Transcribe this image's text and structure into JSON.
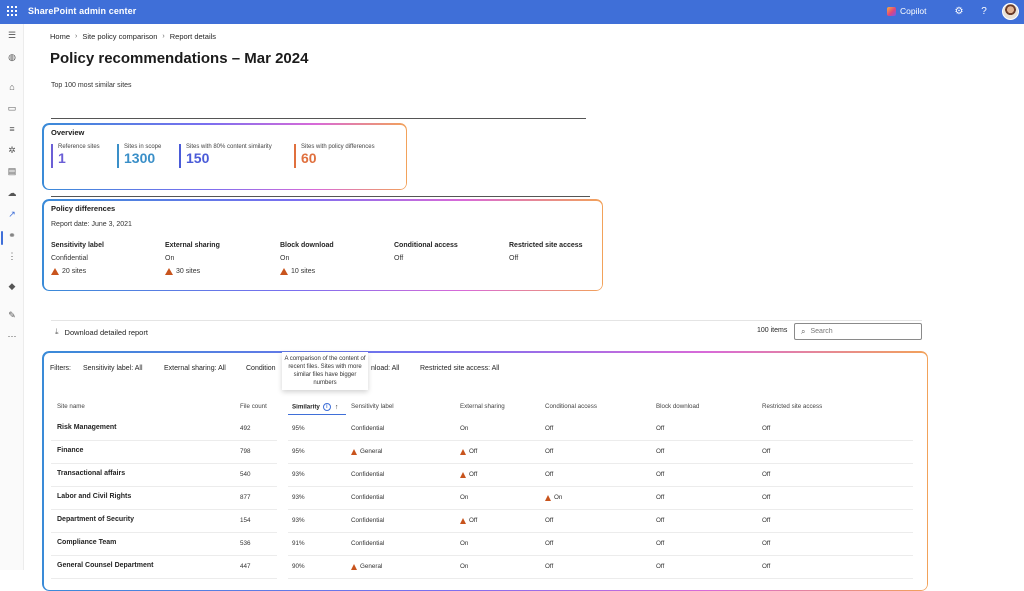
{
  "app": {
    "title": "SharePoint admin center",
    "copilot_label": "Copilot"
  },
  "colors": {
    "topbar": "#3f6fd8",
    "warning": "#c8541d",
    "stat_reference": "#6b5fd6",
    "stat_scope": "#3a8fc8",
    "stat_similarity": "#4a5bd8",
    "stat_policy": "#e0703e"
  },
  "breadcrumb": [
    "Home",
    "Site policy comparison",
    "Report details"
  ],
  "page": {
    "title": "Policy recommendations – Mar 2024",
    "subtitle": "Top 100 most similar sites"
  },
  "overview": {
    "title": "Overview",
    "stats": [
      {
        "label": "Reference sites",
        "value": "1"
      },
      {
        "label": "Sites in scope",
        "value": "1300"
      },
      {
        "label": "Sites with 80% content similarity",
        "value": "150"
      },
      {
        "label": "Sites with policy differences",
        "value": "60"
      }
    ]
  },
  "policy_differences": {
    "title": "Policy differences",
    "report_date": "Report date: June 3, 2021",
    "columns": [
      {
        "header": "Sensitivity label",
        "value": "Confidential",
        "warning": "20 sites"
      },
      {
        "header": "External sharing",
        "value": "On",
        "warning": "30 sites"
      },
      {
        "header": "Block download",
        "value": "On",
        "warning": "10 sites"
      },
      {
        "header": "Conditional access",
        "value": "Off",
        "warning": ""
      },
      {
        "header": "Restricted site access",
        "value": "Off",
        "warning": ""
      }
    ]
  },
  "toolbar": {
    "download_label": "Download detailed report",
    "items_count": "100 items",
    "search_placeholder": "Search"
  },
  "filters": {
    "label": "Filters:",
    "items": [
      "Sensitivity label: All",
      "External sharing: All",
      "Condition",
      "nload: All",
      "Restricted site access: All"
    ]
  },
  "tooltip": "A comparison of the content of recent files. Sites with more similar files have bigger numbers",
  "table": {
    "headers": [
      "Site name",
      "File count",
      "Similarity",
      "Sensitivity label",
      "External sharing",
      "Conditional access",
      "Block download",
      "Restricted site access"
    ],
    "rows": [
      {
        "name": "Risk Management",
        "files": "492",
        "similarity": "95%",
        "label": "Confidential",
        "label_warn": false,
        "sharing": "On",
        "sharing_warn": false,
        "cond": "Off",
        "cond_warn": false,
        "block": "Off",
        "restricted": "Off"
      },
      {
        "name": "Finance",
        "files": "798",
        "similarity": "95%",
        "label": "General",
        "label_warn": true,
        "sharing": "Off",
        "sharing_warn": true,
        "cond": "Off",
        "cond_warn": false,
        "block": "Off",
        "restricted": "Off"
      },
      {
        "name": "Transactional affairs",
        "files": "540",
        "similarity": "93%",
        "label": "Confidential",
        "label_warn": false,
        "sharing": "Off",
        "sharing_warn": true,
        "cond": "Off",
        "cond_warn": false,
        "block": "Off",
        "restricted": "Off"
      },
      {
        "name": "Labor and Civil Rights",
        "files": "877",
        "similarity": "93%",
        "label": "Confidential",
        "label_warn": false,
        "sharing": "On",
        "sharing_warn": false,
        "cond": "On",
        "cond_warn": true,
        "block": "Off",
        "restricted": "Off"
      },
      {
        "name": "Department of Security",
        "files": "154",
        "similarity": "93%",
        "label": "Confidential",
        "label_warn": false,
        "sharing": "Off",
        "sharing_warn": true,
        "cond": "Off",
        "cond_warn": false,
        "block": "Off",
        "restricted": "Off"
      },
      {
        "name": "Compliance Team",
        "files": "536",
        "similarity": "91%",
        "label": "Confidential",
        "label_warn": false,
        "sharing": "On",
        "sharing_warn": false,
        "cond": "Off",
        "cond_warn": false,
        "block": "Off",
        "restricted": "Off"
      },
      {
        "name": "General Counsel Department",
        "files": "447",
        "similarity": "90%",
        "label": "General",
        "label_warn": true,
        "sharing": "On",
        "sharing_warn": false,
        "cond": "Off",
        "cond_warn": false,
        "block": "Off",
        "restricted": "Off"
      }
    ]
  }
}
